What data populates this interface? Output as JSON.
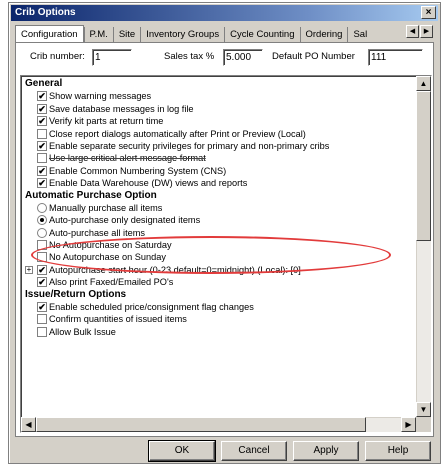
{
  "window": {
    "title": "Crib Options",
    "close_glyph": "×"
  },
  "tabs": [
    {
      "label": "Configuration",
      "active": true
    },
    {
      "label": "P.M."
    },
    {
      "label": "Site"
    },
    {
      "label": "Inventory Groups"
    },
    {
      "label": "Cycle Counting"
    },
    {
      "label": "Ordering"
    },
    {
      "label": "Sal"
    }
  ],
  "tab_scroll": {
    "left": "◀",
    "right": "▶"
  },
  "fields": {
    "crib_number_label": "Crib number:",
    "crib_number_value": "1",
    "sales_tax_label": "Sales tax %",
    "sales_tax_value": "5.000",
    "default_po_label": "Default PO Number",
    "default_po_value": "111"
  },
  "options": [
    {
      "type": "section",
      "label": "General"
    },
    {
      "type": "check",
      "checked": true,
      "label": "Show warning messages"
    },
    {
      "type": "check",
      "checked": true,
      "label": "Save database messages in log file"
    },
    {
      "type": "check",
      "checked": true,
      "label": "Verify kit parts at return time"
    },
    {
      "type": "check",
      "checked": false,
      "label": "Close report dialogs automatically after Print or Preview (Local)"
    },
    {
      "type": "check",
      "checked": true,
      "label": "Enable separate security privileges for primary and non-primary cribs"
    },
    {
      "type": "check",
      "checked": false,
      "label": "Use large critical alert message format",
      "strike": true
    },
    {
      "type": "check",
      "checked": true,
      "label": "Enable Common Numbering System (CNS)"
    },
    {
      "type": "check",
      "checked": true,
      "label": "Enable Data Warehouse (DW) views and reports"
    },
    {
      "type": "section",
      "label": "Automatic Purchase Option"
    },
    {
      "type": "radio",
      "checked": false,
      "label": "Manually purchase all items"
    },
    {
      "type": "radio",
      "checked": true,
      "label": "Auto-purchase only designated items"
    },
    {
      "type": "radio",
      "checked": false,
      "label": "Auto-purchase all items"
    },
    {
      "type": "check",
      "checked": false,
      "label": "No Autopurchase on Saturday"
    },
    {
      "type": "check",
      "checked": false,
      "label": "No Autopurchase on Sunday"
    },
    {
      "type": "expander",
      "glyph": "+",
      "label": "Autopurchase start hour (0-23 default=0=midnight) (Local): [0]"
    },
    {
      "type": "check",
      "checked": true,
      "label": "Also print Faxed/Emailed PO's"
    },
    {
      "type": "section",
      "label": "Issue/Return Options"
    },
    {
      "type": "check",
      "checked": true,
      "label": "Enable scheduled price/consignment flag changes"
    },
    {
      "type": "check",
      "checked": false,
      "label": "Confirm quantities of issued items"
    },
    {
      "type": "check",
      "checked": false,
      "label": "Allow Bulk Issue"
    }
  ],
  "scroll": {
    "up": "▲",
    "down": "▼",
    "left": "◀",
    "right": "▶"
  },
  "buttons": {
    "ok": "OK",
    "cancel": "Cancel",
    "apply": "Apply",
    "help": "Help"
  },
  "colors": {
    "highlight_ellipse": "#e23b3b",
    "titlebar": "#0a246a"
  }
}
